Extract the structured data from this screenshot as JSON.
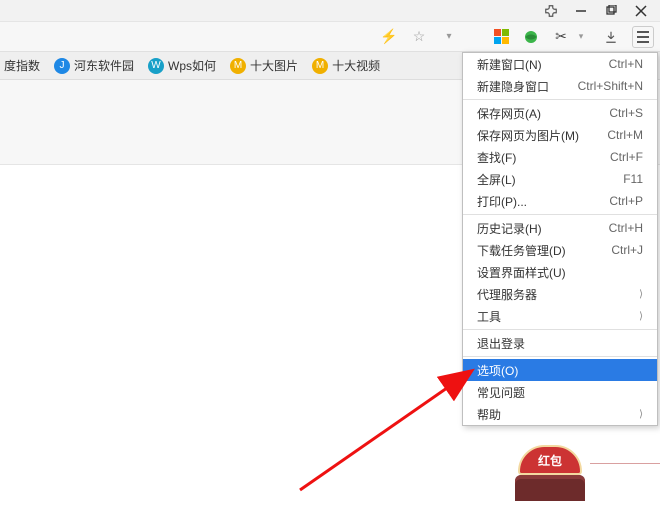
{
  "bookmarks": [
    {
      "label": "度指数",
      "iconText": "",
      "iconBg": ""
    },
    {
      "label": "河东软件园",
      "iconText": "J",
      "iconBg": "#1e88e5"
    },
    {
      "label": "Wps如何",
      "iconText": "W",
      "iconBg": "#18a0c8"
    },
    {
      "label": "十大图片",
      "iconText": "M",
      "iconBg": "#f0b000"
    },
    {
      "label": "十大视频",
      "iconText": "M",
      "iconBg": "#f0b000"
    }
  ],
  "menu": {
    "groups": [
      [
        {
          "label": "新建窗口(N)",
          "shortcut": "Ctrl+N",
          "submenu": false
        },
        {
          "label": "新建隐身窗口",
          "shortcut": "Ctrl+Shift+N",
          "submenu": false
        }
      ],
      [
        {
          "label": "保存网页(A)",
          "shortcut": "Ctrl+S",
          "submenu": false
        },
        {
          "label": "保存网页为图片(M)",
          "shortcut": "Ctrl+M",
          "submenu": false
        },
        {
          "label": "查找(F)",
          "shortcut": "Ctrl+F",
          "submenu": false
        },
        {
          "label": "全屏(L)",
          "shortcut": "F11",
          "submenu": false
        },
        {
          "label": "打印(P)...",
          "shortcut": "Ctrl+P",
          "submenu": false
        }
      ],
      [
        {
          "label": "历史记录(H)",
          "shortcut": "Ctrl+H",
          "submenu": false
        },
        {
          "label": "下载任务管理(D)",
          "shortcut": "Ctrl+J",
          "submenu": false
        },
        {
          "label": "设置界面样式(U)",
          "shortcut": "",
          "submenu": false
        },
        {
          "label": "代理服务器",
          "shortcut": "",
          "submenu": true
        },
        {
          "label": "工具",
          "shortcut": "",
          "submenu": true
        }
      ],
      [
        {
          "label": "退出登录",
          "shortcut": "",
          "submenu": false
        }
      ],
      [
        {
          "label": "选项(O)",
          "shortcut": "",
          "submenu": false,
          "selected": true
        },
        {
          "label": "常见问题",
          "shortcut": "",
          "submenu": false
        },
        {
          "label": "帮助",
          "shortcut": "",
          "submenu": true
        }
      ]
    ]
  },
  "redEnvelope": {
    "label": "红包"
  }
}
